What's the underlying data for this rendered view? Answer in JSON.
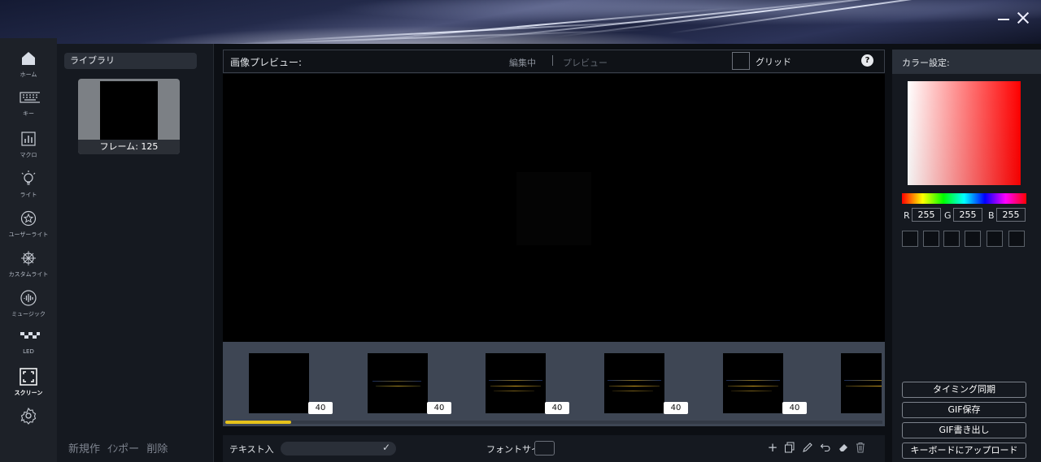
{
  "window": {
    "minimize_icon": "minimize-icon",
    "close_icon": "close-icon"
  },
  "nav": {
    "items": [
      {
        "label": "ホーム",
        "icon": "home-icon"
      },
      {
        "label": "キー",
        "icon": "keyboard-icon"
      },
      {
        "label": "マクロ",
        "icon": "macro-chart-icon"
      },
      {
        "label": "ライト",
        "icon": "lightbulb-icon"
      },
      {
        "label": "ユーザーライト",
        "icon": "star-circle-icon"
      },
      {
        "label": "カスタムライト",
        "icon": "custom-light-icon"
      },
      {
        "label": "ミュージック",
        "icon": "music-wave-icon"
      },
      {
        "label": "LED",
        "icon": "led-grid-icon"
      },
      {
        "label": "スクリーン",
        "icon": "screen-icon",
        "active": true
      }
    ],
    "settings_icon": "settings-gear-icon"
  },
  "library": {
    "title": "ライブラリ",
    "items": [
      {
        "caption": "フレーム: 125"
      }
    ],
    "actions": {
      "new": "新規作",
      "import": "ｲﾝポー",
      "delete": "削除"
    }
  },
  "preview": {
    "title": "画像プレビュー:",
    "mode_edit": "編集中",
    "mode_preview": "プレビュー",
    "grid_label": "グリッド",
    "help_label": "?"
  },
  "timeline": {
    "frames": [
      {
        "duration": "40"
      },
      {
        "duration": "40"
      },
      {
        "duration": "40"
      },
      {
        "duration": "40"
      },
      {
        "duration": "40"
      }
    ],
    "progress": 0.1
  },
  "bottom_bar": {
    "text_label": "テキスト入",
    "text_value": "",
    "font_label": "フォントサイ",
    "tools": [
      "add-icon",
      "copy-icon",
      "pencil-icon",
      "undo-icon",
      "eraser-icon",
      "trash-icon"
    ]
  },
  "color_panel": {
    "title": "カラー設定:",
    "r_label": "R",
    "r": "255",
    "g_label": "G",
    "g": "255",
    "b_label": "B",
    "b": "255",
    "accent": "#ff0000",
    "buttons": {
      "timing_sync": "タイミング同期",
      "gif_save": "GIF保存",
      "gif_export": "GIF書き出し",
      "upload": "キーボードにアップロード"
    }
  }
}
